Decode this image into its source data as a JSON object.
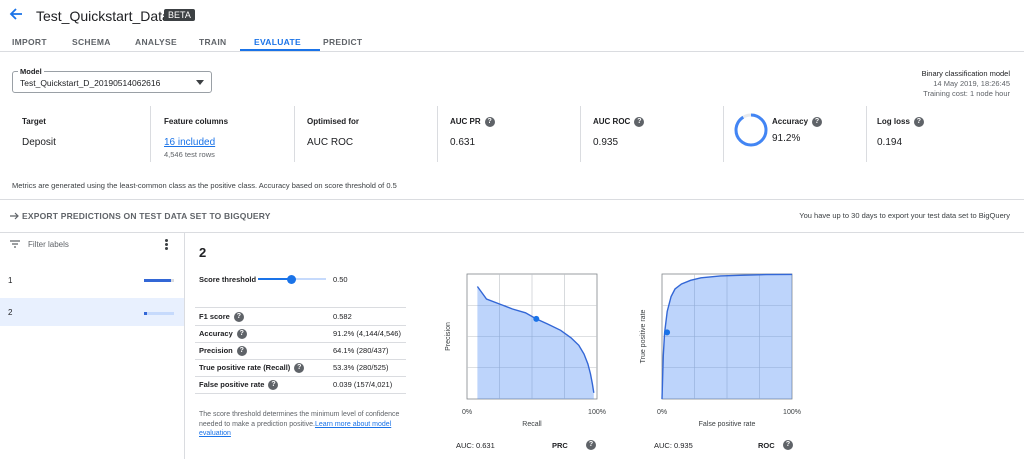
{
  "header": {
    "title": "Test_Quickstart_Dataset",
    "badge": "BETA"
  },
  "tabs": [
    "IMPORT",
    "SCHEMA",
    "ANALYSE",
    "TRAIN",
    "EVALUATE",
    "PREDICT"
  ],
  "model": {
    "label": "Model",
    "value": "Test_Quickstart_D_20190514062616"
  },
  "model_meta": {
    "type": "Binary classification model",
    "date": "14 May 2019, 18:26:45",
    "cost": "Training cost: 1 node hour"
  },
  "metrics": {
    "target": {
      "label": "Target",
      "value": "Deposit"
    },
    "features": {
      "label": "Feature columns",
      "value": "16 included",
      "sub": "4,546 test rows"
    },
    "optimised": {
      "label": "Optimised for",
      "value": "AUC ROC"
    },
    "auc_pr": {
      "label": "AUC PR",
      "value": "0.631"
    },
    "auc_roc": {
      "label": "AUC ROC",
      "value": "0.935"
    },
    "accuracy": {
      "label": "Accuracy",
      "value": "91.2%",
      "fraction": 0.912
    },
    "log_loss": {
      "label": "Log loss",
      "value": "0.194"
    }
  },
  "metrics_note": "Metrics are generated using the least-common class as the positive class. Accuracy based on score threshold of 0.5",
  "export": {
    "label": "EXPORT PREDICTIONS ON TEST DATA SET TO BIGQUERY",
    "note": "You have up to 30 days to export your test data set to BigQuery"
  },
  "labels_panel": {
    "filter_placeholder": "Filter labels",
    "items": [
      {
        "label": "1",
        "fraction": 0.9
      },
      {
        "label": "2",
        "fraction": 0.09
      }
    ]
  },
  "detail": {
    "title": "2",
    "threshold_label": "Score threshold",
    "threshold_value": "0.50",
    "stats": [
      {
        "label": "F1 score",
        "value": "0.582"
      },
      {
        "label": "Accuracy",
        "value": "91.2% (4,144/4,546)"
      },
      {
        "label": "Precision",
        "value": "64.1% (280/437)"
      },
      {
        "label": "True positive rate (Recall)",
        "value": "53.3% (280/525)"
      },
      {
        "label": "False positive rate",
        "value": "0.039 (157/4,021)"
      }
    ],
    "note_text": "The score threshold determines the minimum level of confidence needed to make a prediction positive.",
    "note_link": "Learn more about model evaluation"
  },
  "chart_data": [
    {
      "type": "area",
      "ylabel": "Precision",
      "xlabel": "Recall",
      "x_ticks": [
        "0%",
        "100%"
      ],
      "xlim": [
        0,
        1
      ],
      "ylim": [
        0,
        1
      ],
      "x": [
        0.08,
        0.15,
        0.25,
        0.35,
        0.45,
        0.533,
        0.62,
        0.72,
        0.8,
        0.86,
        0.9,
        0.93,
        0.95,
        0.965,
        0.975
      ],
      "y": [
        0.9,
        0.8,
        0.76,
        0.72,
        0.69,
        0.641,
        0.6,
        0.55,
        0.49,
        0.43,
        0.36,
        0.28,
        0.2,
        0.12,
        0.05
      ],
      "marker": {
        "x": 0.533,
        "y": 0.641
      },
      "footer": {
        "auc": "AUC: 0.631",
        "name": "PRC"
      }
    },
    {
      "type": "area",
      "ylabel": "True positive rate",
      "xlabel": "False positive rate",
      "x_ticks": [
        "0%",
        "100%"
      ],
      "xlim": [
        0,
        1
      ],
      "ylim": [
        0,
        1
      ],
      "x": [
        0,
        0.01,
        0.02,
        0.04,
        0.07,
        0.1,
        0.15,
        0.22,
        0.3,
        0.45,
        0.6,
        0.8,
        1.0
      ],
      "y": [
        0,
        0.35,
        0.53,
        0.7,
        0.82,
        0.88,
        0.92,
        0.95,
        0.97,
        0.985,
        0.99,
        0.995,
        0.997
      ],
      "marker": {
        "x": 0.039,
        "y": 0.533
      },
      "footer": {
        "auc": "AUC: 0.935",
        "name": "ROC"
      }
    }
  ]
}
